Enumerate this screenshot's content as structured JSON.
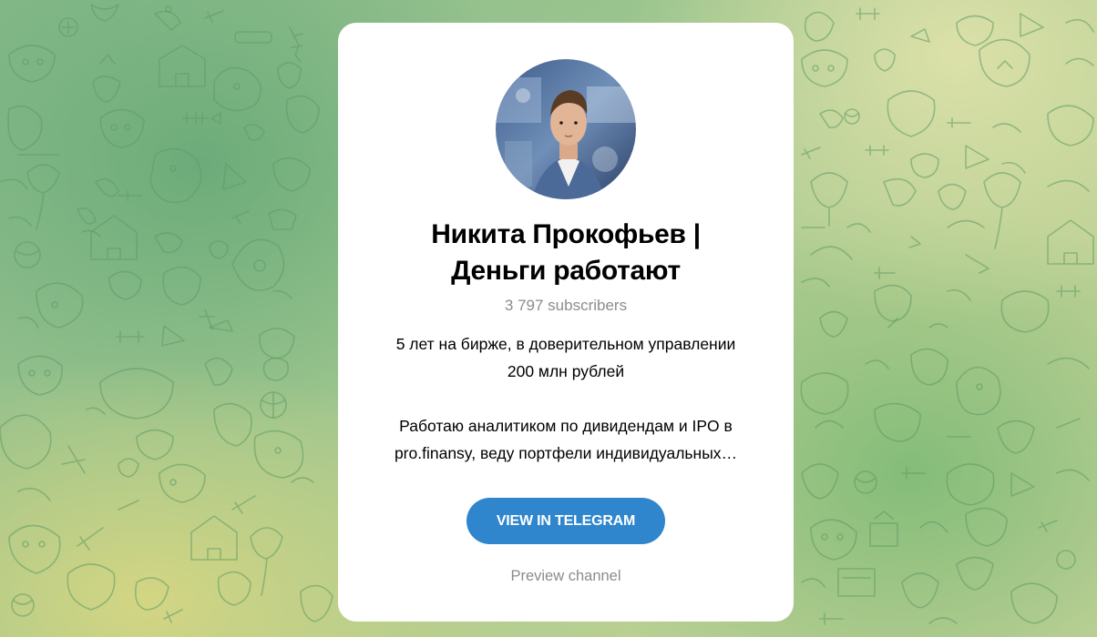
{
  "channel": {
    "title_line1": "Никита Прокофьев |",
    "title_line2": "Деньги работают",
    "subscribers": "3 797 subscribers",
    "description_line1": "5 лет на бирже, в доверительном управлении",
    "description_line2": "200 млн рублей",
    "description_line3": "Работаю аналитиком по дивидендам и IPO в",
    "description_line4": "pro.finansy, веду портфели индивидуальных…"
  },
  "actions": {
    "view_label": "VIEW IN TELEGRAM",
    "preview_label": "Preview channel"
  },
  "colors": {
    "button": "#2f86cd",
    "muted_text": "#8c8c8c",
    "card": "#ffffff"
  }
}
